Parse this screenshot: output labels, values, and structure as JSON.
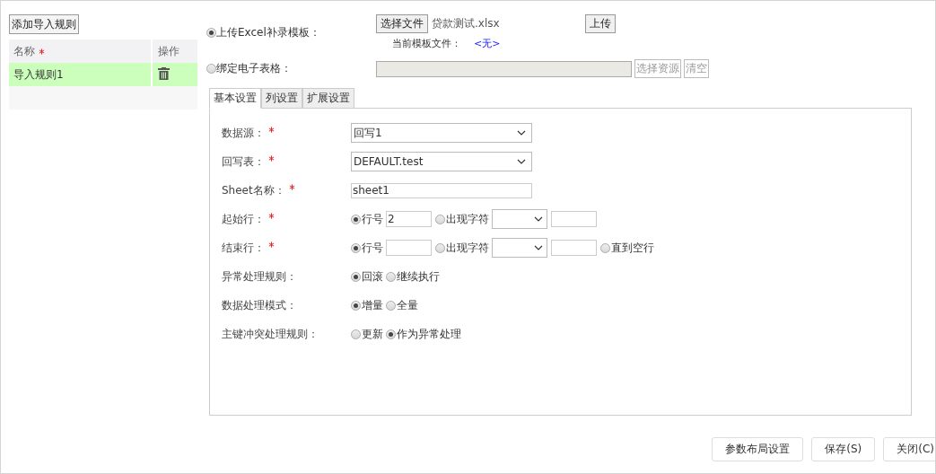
{
  "rules_panel": {
    "add_button": "添加导入规则",
    "columns": [
      {
        "label": "名称",
        "required": true
      },
      {
        "label": "操作",
        "required": false
      }
    ],
    "rows": [
      {
        "name": "导入规则1",
        "selected": true
      }
    ]
  },
  "source_options": [
    {
      "label": "上传Excel补录模板：",
      "selected": true
    },
    {
      "label": "绑定电子表格：",
      "selected": false
    }
  ],
  "upload": {
    "choose_button": "选择文件",
    "file_name": "贷款测试.xlsx",
    "upload_button": "上传",
    "current_label": "当前模板文件：",
    "current_value": "<无>"
  },
  "bind": {
    "select_button": "选择资源",
    "clear_button": "清空",
    "disabled": true
  },
  "tabs": [
    {
      "label": "基本设置",
      "selected": true
    },
    {
      "label": "列设置",
      "selected": false
    },
    {
      "label": "扩展设置",
      "selected": false
    }
  ],
  "form": [
    {
      "label": "数据源：",
      "required": true,
      "kind": "select",
      "value": "回写1"
    },
    {
      "label": "回写表：",
      "required": true,
      "kind": "select",
      "value": "DEFAULT.test"
    },
    {
      "label": "Sheet名称：",
      "required": true,
      "kind": "text",
      "value": "sheet1"
    },
    {
      "label": "起始行：",
      "required": true,
      "kind": "options",
      "items": [
        {
          "kind": "radio",
          "label": "行号",
          "selected": true
        },
        {
          "kind": "input",
          "value": "2"
        },
        {
          "kind": "radio",
          "label": "出现字符",
          "selected": false
        },
        {
          "kind": "select"
        },
        {
          "kind": "input"
        }
      ]
    },
    {
      "label": "结束行：",
      "required": true,
      "kind": "options",
      "items": [
        {
          "kind": "radio",
          "label": "行号",
          "selected": true
        },
        {
          "kind": "input"
        },
        {
          "kind": "radio",
          "label": "出现字符",
          "selected": false
        },
        {
          "kind": "select"
        },
        {
          "kind": "input"
        },
        {
          "kind": "radio",
          "label": "直到空行",
          "selected": false
        }
      ]
    },
    {
      "label": "异常处理规则：",
      "required": false,
      "kind": "options",
      "items": [
        {
          "kind": "radio",
          "label": "回滚",
          "selected": true
        },
        {
          "kind": "radio",
          "label": "继续执行",
          "selected": false
        }
      ]
    },
    {
      "label": "数据处理模式：",
      "required": false,
      "kind": "options",
      "items": [
        {
          "kind": "radio",
          "label": "增量",
          "selected": true
        },
        {
          "kind": "radio",
          "label": "全量",
          "selected": false
        }
      ]
    },
    {
      "label": "主键冲突处理规则：",
      "required": false,
      "kind": "options",
      "items": [
        {
          "kind": "radio",
          "label": "更新",
          "selected": false
        },
        {
          "kind": "radio",
          "label": "作为异常处理",
          "selected": true
        }
      ]
    }
  ],
  "footer_buttons": [
    "参数布局设置",
    "保存(S)",
    "关闭(C)"
  ]
}
